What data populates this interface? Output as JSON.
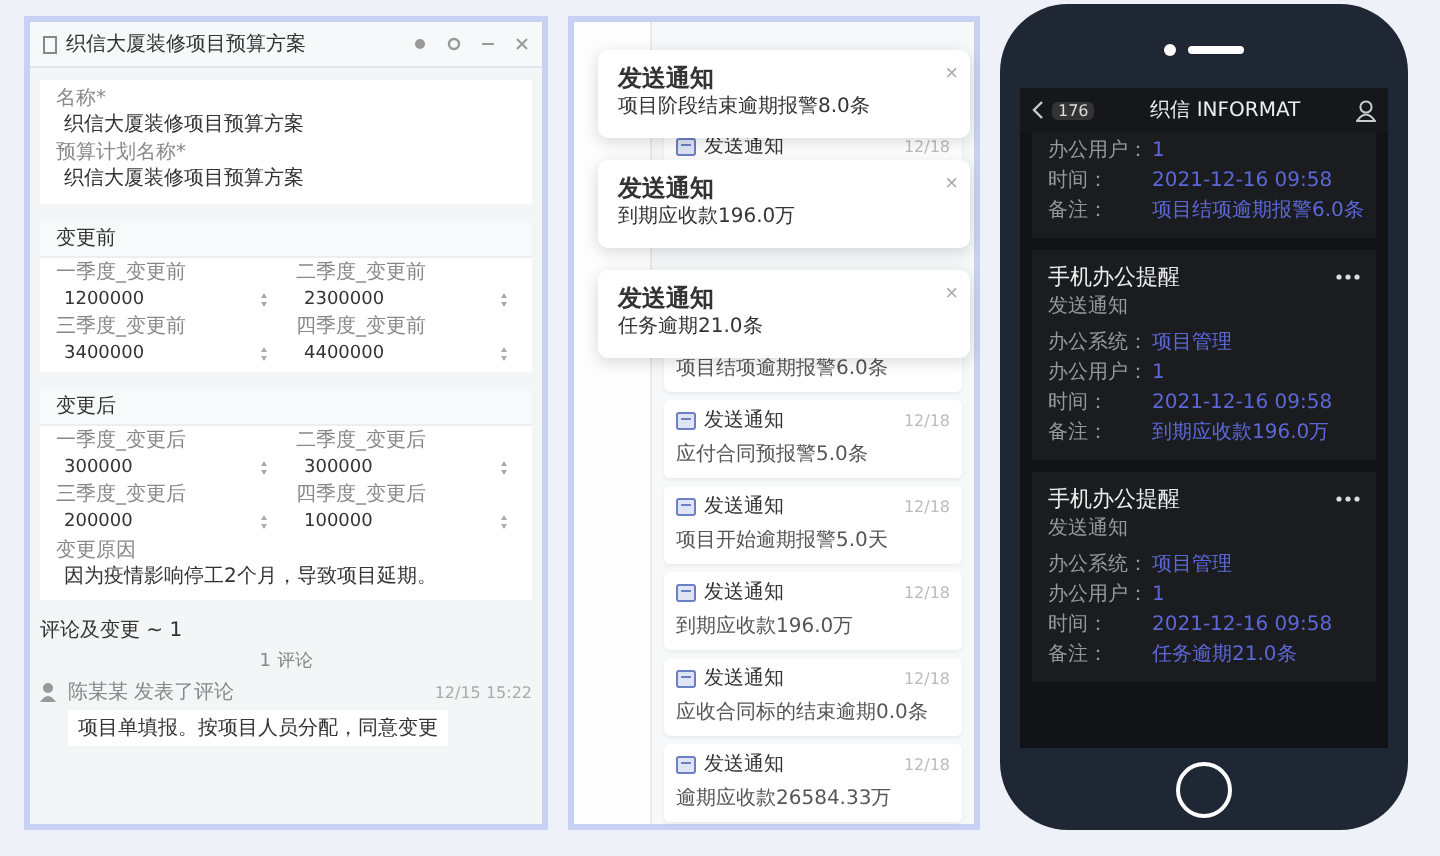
{
  "form_window": {
    "title": "织信大厦装修项目预算方案",
    "basic_fields": [
      {
        "label": "名称*",
        "value": "织信大厦装修项目预算方案"
      },
      {
        "label": "预算计划名称*",
        "value": "织信大厦装修项目预算方案"
      }
    ],
    "sections": [
      {
        "title": "变更前",
        "fields": [
          {
            "label": "一季度_变更前",
            "value": "1200000"
          },
          {
            "label": "二季度_变更前",
            "value": "2300000"
          },
          {
            "label": "三季度_变更前",
            "value": "3400000"
          },
          {
            "label": "四季度_变更前",
            "value": "4400000"
          }
        ]
      },
      {
        "title": "变更后",
        "fields": [
          {
            "label": "一季度_变更后",
            "value": "300000"
          },
          {
            "label": "二季度_变更后",
            "value": "300000"
          },
          {
            "label": "三季度_变更后",
            "value": "200000"
          },
          {
            "label": "四季度_变更后",
            "value": "100000"
          }
        ],
        "note": {
          "label": "变更原因",
          "value": "因为疫情影响停工2个月，导致项目延期。"
        }
      }
    ],
    "comments": {
      "title": "评论及变更 ~ 1",
      "divider": "1 评论",
      "author": "陈某某 发表了评论",
      "time": "12/15 15:22",
      "text": "项目单填报。按项目人员分配，同意变更"
    }
  },
  "notifications": {
    "list": [
      {
        "title": "发送通知",
        "date": "12/18"
      },
      {
        "body": "项目结项逾期报警6.0条"
      },
      {
        "title": "发送通知",
        "date": "12/18",
        "body": "应付合同预报警5.0条"
      },
      {
        "title": "发送通知",
        "date": "12/18",
        "body": "项目开始逾期报警5.0天"
      },
      {
        "title": "发送通知",
        "date": "12/18",
        "body": "到期应收款196.0万"
      },
      {
        "title": "发送通知",
        "date": "12/18",
        "body": "应收合同标的结束逾期0.0条"
      },
      {
        "title": "发送通知",
        "date": "12/18",
        "body": "逾期应收款26584.33万"
      }
    ],
    "toasts": [
      {
        "title": "发送通知",
        "message": "项目阶段结束逾期报警8.0条",
        "close": "×"
      },
      {
        "title": "发送通知",
        "message": "到期应收款196.0万",
        "close": "×"
      },
      {
        "title": "发送通知",
        "message": "任务逾期21.0条",
        "close": "×"
      }
    ]
  },
  "phone": {
    "back": "176",
    "title": "织信 INFORMAT",
    "cards": [
      {
        "rows": [
          {
            "label": "办公用户：",
            "value": "1"
          },
          {
            "label": "时间：",
            "value": "2021-12-16 09:58"
          },
          {
            "label": "备注：",
            "value": "项目结项逾期报警6.0条"
          }
        ]
      },
      {
        "title": "手机办公提醒",
        "subtitle": "发送通知",
        "rows": [
          {
            "label": "办公系统：",
            "value": "项目管理"
          },
          {
            "label": "办公用户：",
            "value": "1"
          },
          {
            "label": "时间：",
            "value": "2021-12-16 09:58"
          },
          {
            "label": "备注：",
            "value": "到期应收款196.0万"
          }
        ]
      },
      {
        "title": "手机办公提醒",
        "subtitle": "发送通知",
        "rows": [
          {
            "label": "办公系统：",
            "value": "项目管理"
          },
          {
            "label": "办公用户：",
            "value": "1"
          },
          {
            "label": "时间：",
            "value": "2021-12-16 09:58"
          },
          {
            "label": "备注：",
            "value": "任务逾期21.0条"
          }
        ]
      }
    ]
  }
}
